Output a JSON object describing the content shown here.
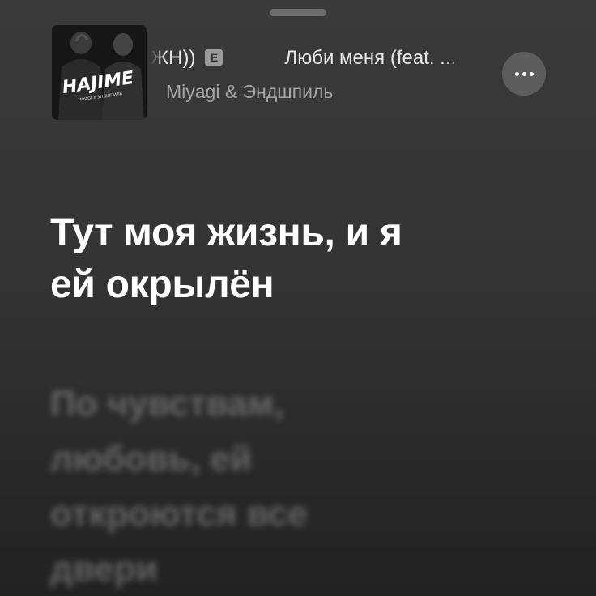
{
  "now_playing": {
    "title_visible_prefix": "ЖН))",
    "explicit_badge": "E",
    "title_visible_next": "Люби меня (feat. ...",
    "artist": "Miyagi & Эндшпиль",
    "artwork_text": "HAJIME",
    "artwork_subtext": "MIYAGI X ЭНДШПИЛЬ",
    "more_icon": "ellipsis-icon"
  },
  "lyrics": {
    "previous_line": "",
    "current_line_1": "Тут моя жизнь, и я",
    "current_line_2": "ей окрылён",
    "next_line_1": "По чувствам,",
    "next_line_2": "любовь, ей",
    "next_line_3": "откроются все",
    "next_line_4": "двери"
  },
  "colors": {
    "background": "#333333",
    "current_lyric": "#ffffff",
    "upcoming_lyric": "#8a8a8a",
    "artist_text": "#a6a6a6",
    "more_button_bg": "#5d5d5d"
  }
}
